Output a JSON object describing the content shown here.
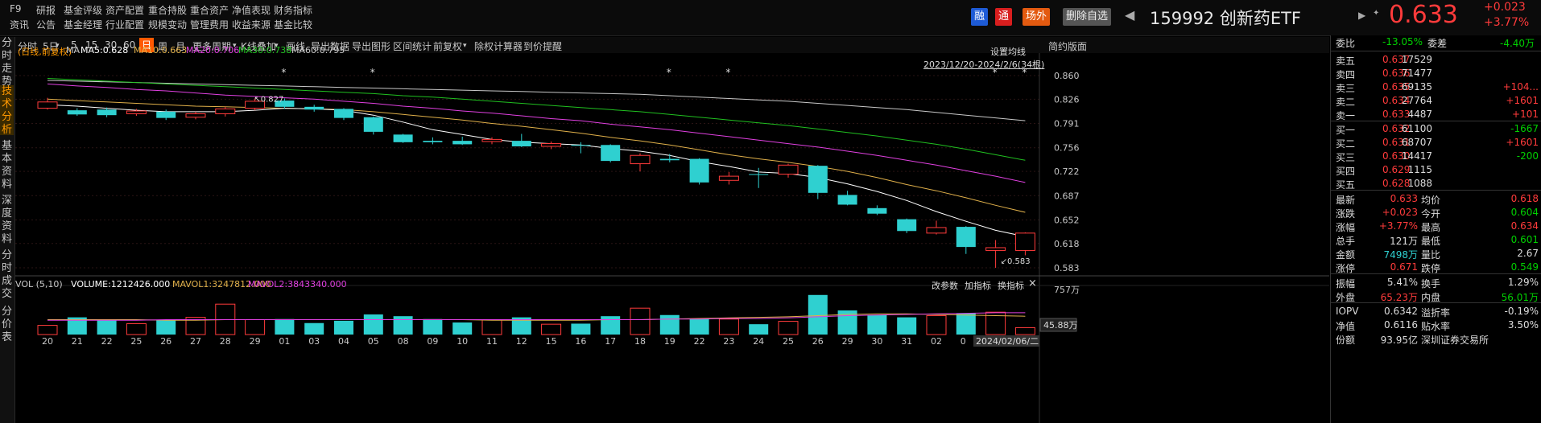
{
  "topbar": {
    "menu_row1": [
      "F9",
      "研报",
      "基金评级",
      "资产配置",
      "重合持股",
      "重合资产",
      "净值表现",
      "财务指标"
    ],
    "menu_row2": [
      "资讯",
      "公告",
      "基金经理",
      "行业配置",
      "规模变动",
      "管理费用",
      "收益来源",
      "基金比较"
    ],
    "badges": [
      "融",
      "通",
      "场外"
    ],
    "remove_watch": "删除自选",
    "code_name": "159992 创新药ETF",
    "price": "0.633",
    "change": "+0.023",
    "change_pct": "+3.77%"
  },
  "left_tabs": [
    "分时走势",
    "技术分析",
    "基本资料",
    "深度资料",
    "分时成交",
    "分价表"
  ],
  "toolbar": {
    "items": [
      "分时",
      "5日",
      "5",
      "15",
      "30",
      "60",
      "日",
      "周",
      "月",
      "更多周期",
      "K线叠加",
      "画线",
      "导出数据",
      "导出图形",
      "区间统计",
      "前复权",
      "除权计算器",
      "到价提醒"
    ],
    "simple_layout": "简约版面"
  },
  "ma_legend": {
    "label": "(日线,前复权)",
    "ma": "MA",
    "ma5": "MA5:0.628",
    "ma10": "MA10:0.663",
    "ma20": "MA20:0.706",
    "ma30": "MA30:0.738",
    "ma60": "MA60:0.795",
    "set_ma": "设置均线",
    "range": "2023/12/20-2024/2/6(34根)"
  },
  "vol_legend": {
    "vol": "VOL (5,10)",
    "volume": "VOLUME:1212426.000",
    "mavol1": "MAVOL1:3247812.000",
    "mavol2": "MAVOL2:3843340.000",
    "change_param": "改参数",
    "add_indicator": "加指标",
    "switch_indicator": "换指标",
    "close": "×"
  },
  "colors": {
    "up": "#ff3b3b",
    "down": "#2fd0d0",
    "ma5": "#ffffff",
    "ma10": "#e0b04a",
    "ma20": "#e040e0",
    "ma30": "#20c020",
    "ma60": "#c8c8c8",
    "accent": "#ff5a00"
  },
  "chart_data": {
    "type": "candlestick",
    "price_ticks": [
      "0.860",
      "0.826",
      "0.791",
      "0.756",
      "0.722",
      "0.687",
      "0.652",
      "0.618",
      "0.583"
    ],
    "ylim": [
      0.583,
      0.86
    ],
    "volume_ticks": [
      "757万",
      "45.88万"
    ],
    "x_labels": [
      "20",
      "21",
      "22",
      "25",
      "26",
      "27",
      "28",
      "29",
      "01",
      "03",
      "04",
      "05",
      "08",
      "09",
      "10",
      "11",
      "12",
      "15",
      "16",
      "17",
      "18",
      "19",
      "22",
      "23",
      "24",
      "25",
      "26",
      "29",
      "30",
      "31",
      "02",
      "0",
      "2024/02/06/二"
    ],
    "high_label": "0.827",
    "low_label": "0.583",
    "candles": [
      {
        "o": 0.813,
        "c": 0.822,
        "h": 0.828,
        "l": 0.811
      },
      {
        "o": 0.81,
        "c": 0.804,
        "h": 0.813,
        "l": 0.802
      },
      {
        "o": 0.811,
        "c": 0.803,
        "h": 0.814,
        "l": 0.8
      },
      {
        "o": 0.805,
        "c": 0.809,
        "h": 0.812,
        "l": 0.802
      },
      {
        "o": 0.808,
        "c": 0.799,
        "h": 0.811,
        "l": 0.796
      },
      {
        "o": 0.8,
        "c": 0.805,
        "h": 0.808,
        "l": 0.797
      },
      {
        "o": 0.805,
        "c": 0.812,
        "h": 0.815,
        "l": 0.801
      },
      {
        "o": 0.813,
        "c": 0.823,
        "h": 0.827,
        "l": 0.81
      },
      {
        "o": 0.824,
        "c": 0.815,
        "h": 0.827,
        "l": 0.812
      },
      {
        "o": 0.815,
        "c": 0.811,
        "h": 0.818,
        "l": 0.808
      },
      {
        "o": 0.812,
        "c": 0.799,
        "h": 0.813,
        "l": 0.796
      },
      {
        "o": 0.8,
        "c": 0.779,
        "h": 0.801,
        "l": 0.775
      },
      {
        "o": 0.775,
        "c": 0.764,
        "h": 0.776,
        "l": 0.763
      },
      {
        "o": 0.766,
        "c": 0.764,
        "h": 0.771,
        "l": 0.761
      },
      {
        "o": 0.766,
        "c": 0.761,
        "h": 0.772,
        "l": 0.76
      },
      {
        "o": 0.765,
        "c": 0.768,
        "h": 0.771,
        "l": 0.761
      },
      {
        "o": 0.766,
        "c": 0.758,
        "h": 0.776,
        "l": 0.757
      },
      {
        "o": 0.758,
        "c": 0.762,
        "h": 0.765,
        "l": 0.754
      },
      {
        "o": 0.76,
        "c": 0.759,
        "h": 0.764,
        "l": 0.748
      },
      {
        "o": 0.76,
        "c": 0.737,
        "h": 0.761,
        "l": 0.735
      },
      {
        "o": 0.733,
        "c": 0.745,
        "h": 0.748,
        "l": 0.722
      },
      {
        "o": 0.74,
        "c": 0.738,
        "h": 0.747,
        "l": 0.735
      },
      {
        "o": 0.74,
        "c": 0.706,
        "h": 0.741,
        "l": 0.703
      },
      {
        "o": 0.709,
        "c": 0.715,
        "h": 0.721,
        "l": 0.703
      },
      {
        "o": 0.718,
        "c": 0.717,
        "h": 0.727,
        "l": 0.698
      },
      {
        "o": 0.718,
        "c": 0.731,
        "h": 0.733,
        "l": 0.713
      },
      {
        "o": 0.73,
        "c": 0.691,
        "h": 0.731,
        "l": 0.682
      },
      {
        "o": 0.688,
        "c": 0.674,
        "h": 0.694,
        "l": 0.673
      },
      {
        "o": 0.669,
        "c": 0.661,
        "h": 0.673,
        "l": 0.659
      },
      {
        "o": 0.653,
        "c": 0.636,
        "h": 0.654,
        "l": 0.633
      },
      {
        "o": 0.633,
        "c": 0.641,
        "h": 0.651,
        "l": 0.631
      },
      {
        "o": 0.642,
        "c": 0.613,
        "h": 0.643,
        "l": 0.603
      },
      {
        "o": 0.608,
        "c": 0.612,
        "h": 0.623,
        "l": 0.583
      },
      {
        "o": 0.608,
        "c": 0.633,
        "h": 0.634,
        "l": 0.601
      }
    ],
    "ma5": [
      0.818,
      0.816,
      0.813,
      0.81,
      0.808,
      0.808,
      0.808,
      0.81,
      0.813,
      0.812,
      0.81,
      0.803,
      0.793,
      0.782,
      0.775,
      0.768,
      0.764,
      0.762,
      0.76,
      0.755,
      0.751,
      0.745,
      0.736,
      0.729,
      0.721,
      0.719,
      0.713,
      0.704,
      0.693,
      0.68,
      0.664,
      0.65,
      0.637,
      0.628
    ],
    "ma10": [
      0.826,
      0.824,
      0.822,
      0.82,
      0.818,
      0.816,
      0.815,
      0.814,
      0.813,
      0.812,
      0.811,
      0.808,
      0.804,
      0.8,
      0.796,
      0.791,
      0.787,
      0.782,
      0.777,
      0.771,
      0.766,
      0.76,
      0.753,
      0.746,
      0.74,
      0.735,
      0.729,
      0.722,
      0.713,
      0.703,
      0.694,
      0.684,
      0.673,
      0.663
    ],
    "ma20": [
      0.848,
      0.845,
      0.843,
      0.84,
      0.838,
      0.835,
      0.832,
      0.83,
      0.828,
      0.826,
      0.823,
      0.82,
      0.816,
      0.813,
      0.809,
      0.806,
      0.802,
      0.798,
      0.795,
      0.79,
      0.786,
      0.782,
      0.777,
      0.772,
      0.767,
      0.762,
      0.757,
      0.751,
      0.745,
      0.738,
      0.731,
      0.723,
      0.715,
      0.706
    ],
    "ma30": [
      0.856,
      0.854,
      0.852,
      0.85,
      0.848,
      0.846,
      0.844,
      0.842,
      0.84,
      0.838,
      0.836,
      0.834,
      0.831,
      0.829,
      0.826,
      0.823,
      0.82,
      0.817,
      0.814,
      0.811,
      0.808,
      0.804,
      0.8,
      0.796,
      0.792,
      0.788,
      0.783,
      0.778,
      0.773,
      0.767,
      0.761,
      0.754,
      0.746,
      0.738
    ],
    "ma60": [
      0.853,
      0.852,
      0.851,
      0.85,
      0.849,
      0.848,
      0.847,
      0.846,
      0.845,
      0.844,
      0.843,
      0.842,
      0.841,
      0.84,
      0.839,
      0.838,
      0.837,
      0.836,
      0.835,
      0.834,
      0.833,
      0.831,
      0.829,
      0.827,
      0.825,
      0.823,
      0.82,
      0.817,
      0.814,
      0.811,
      0.807,
      0.803,
      0.799,
      0.795
    ],
    "volumes": [
      1.6,
      3.0,
      2.5,
      1.9,
      2.6,
      3.0,
      5.3,
      2.6,
      2.7,
      2.0,
      2.4,
      3.5,
      3.2,
      2.7,
      2.1,
      2.6,
      3.0,
      1.8,
      1.9,
      3.2,
      4.6,
      3.4,
      2.8,
      2.7,
      1.8,
      2.3,
      6.9,
      4.2,
      3.4,
      3.0,
      3.3,
      3.7,
      3.9,
      1.2
    ],
    "mavol1": [
      2.6,
      2.6,
      2.6,
      2.6,
      2.5,
      2.5,
      2.6,
      2.6,
      2.6,
      2.6,
      2.6,
      2.6,
      2.6,
      2.6,
      2.6,
      2.5,
      2.5,
      2.5,
      2.5,
      2.6,
      2.6,
      2.7,
      2.8,
      2.9,
      3.0,
      3.1,
      3.3,
      3.5,
      3.6,
      3.6,
      3.5,
      3.4,
      3.3,
      3.2
    ],
    "mavol2": [
      2.5,
      2.5,
      2.5,
      2.5,
      2.6,
      2.6,
      2.6,
      2.6,
      2.6,
      2.6,
      2.6,
      2.6,
      2.6,
      2.6,
      2.6,
      2.6,
      2.6,
      2.6,
      2.6,
      2.6,
      2.6,
      2.7,
      2.7,
      2.8,
      2.8,
      2.9,
      3.1,
      3.3,
      3.4,
      3.5,
      3.6,
      3.7,
      3.8,
      3.8
    ],
    "vol_max": 7.57,
    "stars_at": [
      8,
      11,
      21,
      23,
      32,
      33
    ]
  },
  "quote": {
    "weibi": {
      "label": "委比",
      "value": "-13.05%"
    },
    "weicha": {
      "label": "委差",
      "value": "-4.40万"
    },
    "sells": [
      {
        "label": "卖五",
        "price": "0.637",
        "vol": "17529",
        "chg": ""
      },
      {
        "label": "卖四",
        "price": "0.636",
        "vol": "71477",
        "chg": ""
      },
      {
        "label": "卖三",
        "price": "0.635",
        "vol": "69135",
        "chg": "+104..."
      },
      {
        "label": "卖二",
        "price": "0.634",
        "vol": "27764",
        "chg": "+1601"
      },
      {
        "label": "卖一",
        "price": "0.633",
        "vol": "4487",
        "chg": "+101"
      }
    ],
    "buys": [
      {
        "label": "买一",
        "price": "0.632",
        "vol": "61100",
        "chg": "-1667"
      },
      {
        "label": "买二",
        "price": "0.631",
        "vol": "68707",
        "chg": "+1601"
      },
      {
        "label": "买三",
        "price": "0.630",
        "vol": "14417",
        "chg": "-200"
      },
      {
        "label": "买四",
        "price": "0.629",
        "vol": "1115",
        "chg": ""
      },
      {
        "label": "买五",
        "price": "0.628",
        "vol": "1088",
        "chg": ""
      }
    ],
    "stats": [
      {
        "l1": "最新",
        "v1": "0.633",
        "c1": "red",
        "l2": "均价",
        "v2": "0.618",
        "c2": "red"
      },
      {
        "l1": "涨跌",
        "v1": "+0.023",
        "c1": "red",
        "l2": "今开",
        "v2": "0.604",
        "c2": "green"
      },
      {
        "l1": "涨幅",
        "v1": "+3.77%",
        "c1": "red",
        "l2": "最高",
        "v2": "0.634",
        "c2": "red"
      },
      {
        "l1": "总手",
        "v1": "121万",
        "c1": "white",
        "l2": "最低",
        "v2": "0.601",
        "c2": "green"
      },
      {
        "l1": "金额",
        "v1": "7498万",
        "c1": "cyan",
        "l2": "量比",
        "v2": "2.67",
        "c2": "white"
      },
      {
        "l1": "涨停",
        "v1": "0.671",
        "c1": "red",
        "l2": "跌停",
        "v2": "0.549",
        "c2": "green"
      }
    ],
    "stats2": [
      {
        "l1": "振幅",
        "v1": "5.41%",
        "c1": "white",
        "l2": "换手",
        "v2": "1.29%",
        "c2": "white"
      },
      {
        "l1": "外盘",
        "v1": "65.23万",
        "c1": "red",
        "l2": "内盘",
        "v2": "56.01万",
        "c2": "green"
      }
    ],
    "stats3": [
      {
        "l1": "IOPV",
        "v1": "0.6342",
        "c1": "white",
        "l2": "溢折率",
        "v2": "-0.19%",
        "c2": "white"
      },
      {
        "l1": "净值",
        "v1": "0.6116",
        "c1": "white",
        "l2": "贴水率",
        "v2": "3.50%",
        "c2": "white"
      },
      {
        "l1": "份额",
        "v1": "93.95亿",
        "c1": "white",
        "l2": "深圳证券交易所",
        "v2": "",
        "c2": "white"
      }
    ]
  }
}
